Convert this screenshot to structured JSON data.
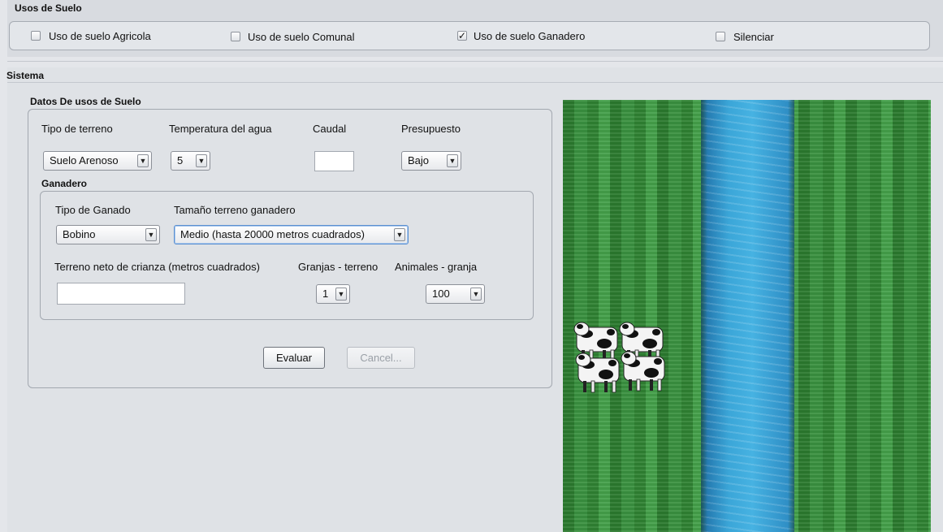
{
  "usos_suelo": {
    "title": "Usos de Suelo",
    "checkboxes": [
      {
        "label": "Uso de suelo Agricola",
        "checked": false
      },
      {
        "label": "Uso de suelo Comunal",
        "checked": false
      },
      {
        "label": "Uso de suelo Ganadero",
        "checked": true
      },
      {
        "label": "Silenciar",
        "checked": false
      }
    ],
    "check_glyph": "✓"
  },
  "sistema": {
    "title": "Sistema",
    "datos": {
      "title": "Datos De usos de Suelo",
      "tipo_terreno": {
        "label": "Tipo de terreno",
        "value": "Suelo Arenoso"
      },
      "temperatura": {
        "label": "Temperatura del agua",
        "value": "5"
      },
      "caudal": {
        "label": "Caudal",
        "value": ""
      },
      "presupuesto": {
        "label": "Presupuesto",
        "value": "Bajo"
      }
    },
    "ganadero": {
      "title": "Ganadero",
      "tipo_ganado": {
        "label": "Tipo de Ganado",
        "value": "Bobino"
      },
      "tamano": {
        "label": "Tamaño terreno ganadero",
        "value": "Medio (hasta 20000 metros cuadrados)"
      },
      "terreno_neto": {
        "label": "Terreno neto de crianza (metros cuadrados)",
        "value": ""
      },
      "granjas": {
        "label": "Granjas - terreno",
        "value": "1"
      },
      "animales": {
        "label": "Animales - granja",
        "value": "100"
      }
    },
    "buttons": {
      "evaluar": "Evaluar",
      "cancel": "Cancel..."
    },
    "dropdown_glyph": "▼"
  },
  "scene": {
    "icon": "cow-herd-icon",
    "colors": {
      "grass": "#3a9140",
      "river": "#3ba6d8"
    }
  }
}
